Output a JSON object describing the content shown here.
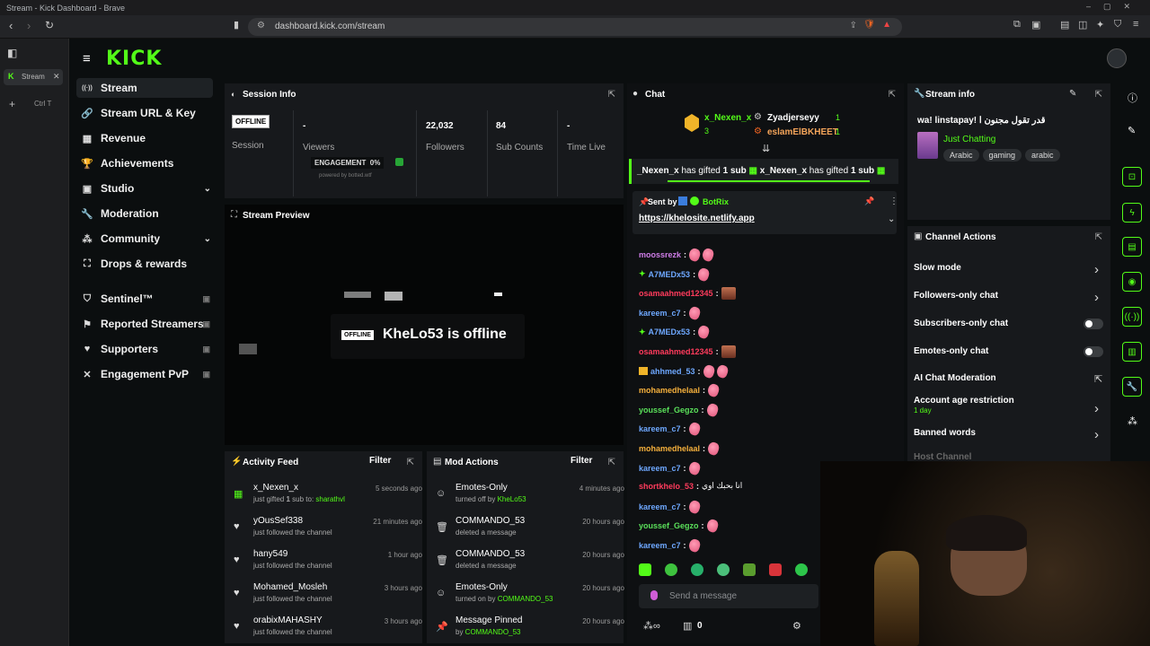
{
  "browser": {
    "window_title": "Stream - Kick Dashboard - Brave",
    "url": "dashboard.kick.com/stream",
    "tab_label": "Stream",
    "tab_hint": "Ctrl T",
    "brand_color": "#53fc18"
  },
  "app": {
    "logo": "KICK"
  },
  "sidebar": {
    "items": [
      {
        "label": "Stream",
        "icon": "broadcast-icon"
      },
      {
        "label": "Stream URL & Key",
        "icon": "link-icon"
      },
      {
        "label": "Revenue",
        "icon": "revenue-icon"
      },
      {
        "label": "Achievements",
        "icon": "trophy-icon"
      },
      {
        "label": "Studio",
        "icon": "studio-icon"
      },
      {
        "label": "Moderation",
        "icon": "wrench-icon"
      },
      {
        "label": "Community",
        "icon": "community-icon"
      },
      {
        "label": "Drops & rewards",
        "icon": "drops-icon"
      },
      {
        "label": "Sentinel™",
        "icon": "shield-icon"
      },
      {
        "label": "Reported Streamers",
        "icon": "flag-icon"
      },
      {
        "label": "Supporters",
        "icon": "heart-icon"
      },
      {
        "label": "Engagement PvP",
        "icon": "versus-icon"
      }
    ]
  },
  "session": {
    "title": "Session Info",
    "status": "OFFLINE",
    "session_label": "Session",
    "viewers_value": "-",
    "viewers_label": "Viewers",
    "followers_value": "22,032",
    "followers_label": "Followers",
    "subs_value": "84",
    "subs_label": "Sub Counts",
    "time_value": "-",
    "time_label": "Time Live",
    "engagement_label": "ENGAGEMENT",
    "engagement_value": "0%",
    "powered": "powered by botted.wtf"
  },
  "preview": {
    "title": "Stream Preview",
    "badge": "OFFLINE",
    "message": "KheLo53 is offline"
  },
  "activity": {
    "title": "Activity Feed",
    "filter": "Filter",
    "items": [
      {
        "name": "x_Nexen_x",
        "sub_pre": "just gifted ",
        "sub_count": "1",
        "sub_mid": " sub to: ",
        "sub_user": "sharathvl",
        "time": "5 seconds ago"
      },
      {
        "name": "yOusSef338",
        "sub": "just followed the channel",
        "time": "21 minutes ago"
      },
      {
        "name": "hany549",
        "sub": "just followed the channel",
        "time": "1 hour ago"
      },
      {
        "name": "Mohamed_Mosleh",
        "sub": "just followed the channel",
        "time": "3 hours ago"
      },
      {
        "name": "orabixMAHASHY",
        "sub": "just followed the channel",
        "time": "3 hours ago"
      }
    ]
  },
  "mod": {
    "title": "Mod Actions",
    "filter": "Filter",
    "items": [
      {
        "name": "Emotes-Only",
        "sub": "turned off by ",
        "user": "KheLo53",
        "time": "4 minutes ago",
        "icon": "emote-icon"
      },
      {
        "name": "COMMANDO_53",
        "sub": "deleted a message",
        "user": "",
        "time": "20 hours ago",
        "icon": "trash-icon"
      },
      {
        "name": "COMMANDO_53",
        "sub": "deleted a message",
        "user": "",
        "time": "20 hours ago",
        "icon": "trash-icon"
      },
      {
        "name": "Emotes-Only",
        "sub": "turned on by ",
        "user": "COMMANDO_53",
        "time": "20 hours ago",
        "icon": "emote-icon"
      },
      {
        "name": "Message Pinned",
        "sub": "by ",
        "user": "COMMANDO_53",
        "time": "20 hours ago",
        "icon": "pin-icon"
      }
    ]
  },
  "chat": {
    "title": "Chat",
    "top_gifters": [
      {
        "name": "x_Nexen_x",
        "count": "3"
      },
      {
        "name": "Zyadjerseyy",
        "count": "1"
      },
      {
        "name": "eslamElBKHEET",
        "count": "1"
      }
    ],
    "gift_banner": [
      {
        "name": "_Nexen_x",
        "text": " has gifted ",
        "count": "1",
        "unit": " sub"
      },
      {
        "name": "x_Nexen_x",
        "text": " has gifted ",
        "count": "1",
        "unit": " sub"
      }
    ],
    "pinned": {
      "sent_by": "Sent by",
      "bot": "BotRix",
      "link": "https://khelosite.netlify.app"
    },
    "messages": [
      {
        "user": "moossrezk",
        "color": "#cf7de8"
      },
      {
        "user": "A7MEDx53",
        "color": "#6ea8ff",
        "badge": "green"
      },
      {
        "user": "osamaahmed12345",
        "color": "#ff3b5c",
        "square": true
      },
      {
        "user": "kareem_c7",
        "color": "#6ea8ff"
      },
      {
        "user": "A7MEDx53",
        "color": "#6ea8ff",
        "badge": "green"
      },
      {
        "user": "osamaahmed12345",
        "color": "#ff3b5c",
        "square": true
      },
      {
        "user": "ahhmed_53",
        "color": "#6ea8ff",
        "badge": "crown"
      },
      {
        "user": "mohamedhelaal",
        "color": "#f5b03c"
      },
      {
        "user": "youssef_Gegzo",
        "color": "#5ae05a"
      },
      {
        "user": "kareem_c7",
        "color": "#6ea8ff"
      },
      {
        "user": "mohamedhelaal",
        "color": "#f5b03c"
      },
      {
        "user": "kareem_c7",
        "color": "#6ea8ff"
      },
      {
        "user": "shortkhelo_53",
        "color": "#ff3b5c",
        "text": "انا بحبك اوي"
      },
      {
        "user": "kareem_c7",
        "color": "#6ea8ff"
      },
      {
        "user": "youssef_Gegzo",
        "color": "#5ae05a"
      },
      {
        "user": "kareem_c7",
        "color": "#6ea8ff"
      }
    ],
    "input_placeholder": "Send a message",
    "count": "0"
  },
  "streaminfo": {
    "title": "Stream info",
    "stream_title": "wa! linstapay! قدر تقول مجنون ا",
    "category": "Just Chatting",
    "tags": [
      "Arabic",
      "gaming",
      "arabic"
    ]
  },
  "actions": {
    "title": "Channel Actions",
    "items": [
      {
        "label": "Slow mode",
        "type": "arrow"
      },
      {
        "label": "Followers-only chat",
        "type": "arrow"
      },
      {
        "label": "Subscribers-only chat",
        "type": "toggle"
      },
      {
        "label": "Emotes-only chat",
        "type": "toggle"
      },
      {
        "label": "AI Chat Moderation",
        "type": "link"
      },
      {
        "label": "Account age restriction",
        "sub": "1 day",
        "type": "arrow"
      },
      {
        "label": "Banned words",
        "type": "arrow"
      },
      {
        "label": "Host Channel",
        "type": "none"
      }
    ]
  }
}
